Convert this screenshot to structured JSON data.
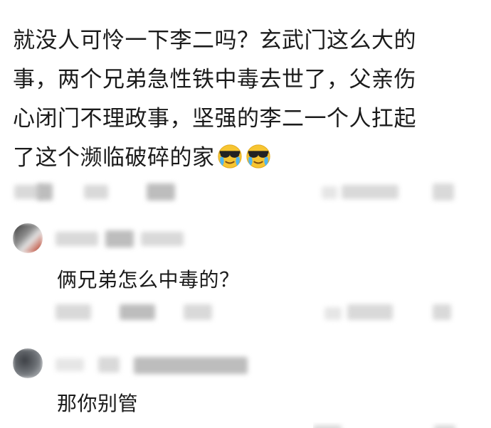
{
  "post": {
    "lines": [
      "就没人可怜一下李二吗？玄武门这么大的",
      "事，两个兄弟急性铁中毒去世了，父亲伤",
      "心闭门不理政事，坚强的李二一个人扛起",
      "了这个濒临破碎的家"
    ],
    "emoji_names": [
      "cool-crying-face-emoji",
      "cool-crying-face-emoji"
    ]
  },
  "comments": [
    {
      "text": "俩兄弟怎么中毒的？",
      "avatar_icon": "user-avatar-icon"
    },
    {
      "text": "那你别管",
      "avatar_icon": "user-avatar-icon"
    }
  ],
  "colors": {
    "text": "#1b1b1b",
    "blur_gray": "#d9d9d9",
    "emoji_face": "#f7c531"
  }
}
